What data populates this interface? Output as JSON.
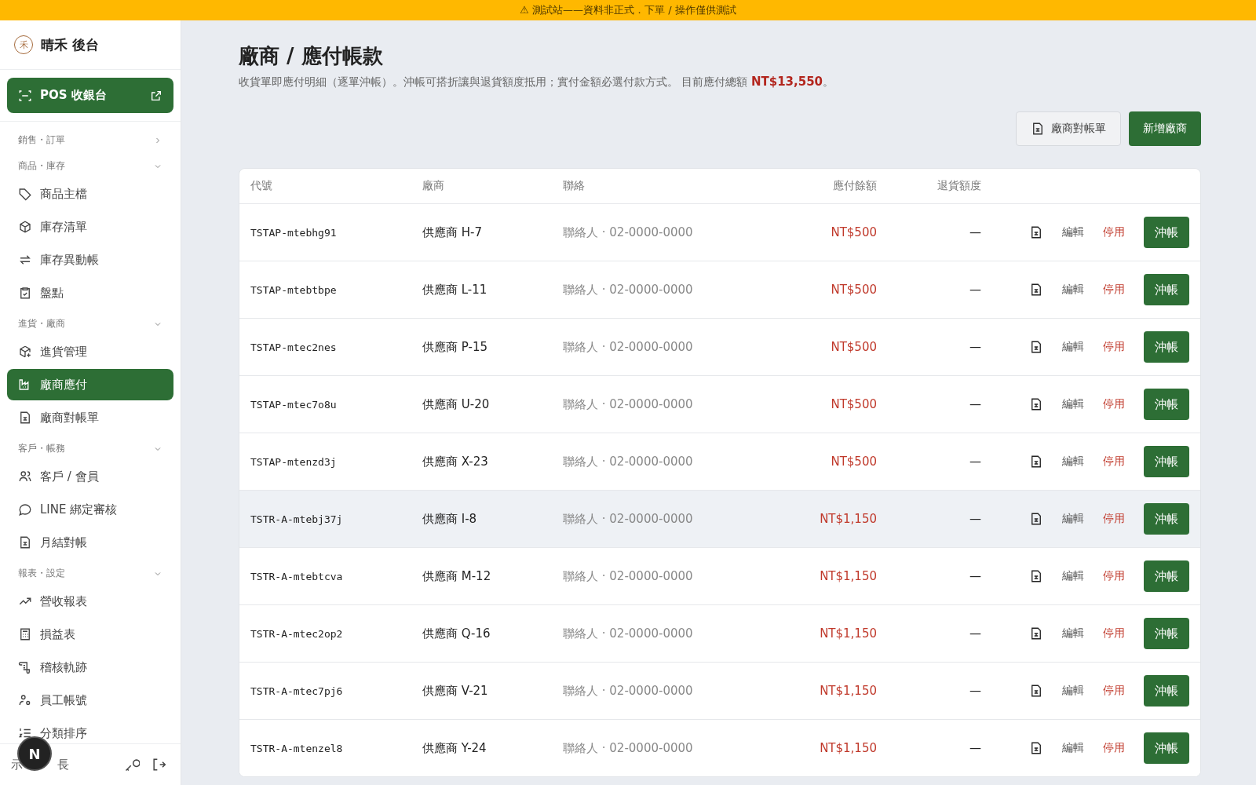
{
  "banner": {
    "icon": "⚠",
    "text": "測試站——資料非正式．下單 / 操作僅供測試"
  },
  "sidebar": {
    "brand": {
      "mark": "禾",
      "name": "晴禾 後台"
    },
    "pos_button": {
      "label": "POS 收銀台"
    },
    "groups": [
      {
        "label": "銷售・訂單",
        "expanded": false
      },
      {
        "label": "商品・庫存",
        "expanded": true,
        "items": [
          {
            "label": "商品主檔",
            "selected": false
          },
          {
            "label": "庫存清單",
            "selected": false
          },
          {
            "label": "庫存異動帳",
            "selected": false
          },
          {
            "label": "盤點",
            "selected": false
          }
        ]
      },
      {
        "label": "進貨・廠商",
        "expanded": true,
        "items": [
          {
            "label": "進貨管理",
            "selected": false
          },
          {
            "label": "廠商應付",
            "selected": true
          },
          {
            "label": "廠商對帳單",
            "selected": false
          }
        ]
      },
      {
        "label": "客戶・帳務",
        "expanded": true,
        "items": [
          {
            "label": "客戶 / 會員",
            "selected": false
          },
          {
            "label": "LINE 綁定審核",
            "selected": false
          },
          {
            "label": "月結對帳",
            "selected": false
          }
        ]
      },
      {
        "label": "報表・設定",
        "expanded": true,
        "items": [
          {
            "label": "營收報表",
            "selected": false
          },
          {
            "label": "損益表",
            "selected": false
          },
          {
            "label": "稽核軌跡",
            "selected": false
          },
          {
            "label": "員工帳號",
            "selected": false
          },
          {
            "label": "分類排序",
            "selected": false
          }
        ]
      }
    ],
    "user": {
      "name_parts": [
        "示",
        "長"
      ]
    },
    "dev_badge": "N"
  },
  "page": {
    "title": "廠商 / 應付帳款",
    "description": "收貨單即應付明細（逐單沖帳）。沖帳可搭折讓與退貨額度抵用；實付金額必選付款方式。 目前應付總額",
    "total": "NT$13,550",
    "description_end": "。",
    "actions": [
      {
        "label": "廠商對帳單",
        "kind": "secondary"
      },
      {
        "label": "新增廠商",
        "kind": "primary"
      }
    ]
  },
  "table": {
    "columns": [
      "代號",
      "廠商",
      "聯絡",
      "應付餘額",
      "退貨額度"
    ],
    "rows": [
      {
        "code": "TSTAP-mtebhg91",
        "vendor": "供應商 H-7",
        "contact": "聯絡人 · 02-0000-0000",
        "balance": "NT$500",
        "credit": "—",
        "hovered": false,
        "edit": "編輯",
        "disable": "停用",
        "settle": "沖帳"
      },
      {
        "code": "TSTAP-mtebtbpe",
        "vendor": "供應商 L-11",
        "contact": "聯絡人 · 02-0000-0000",
        "balance": "NT$500",
        "credit": "—",
        "hovered": false,
        "edit": "編輯",
        "disable": "停用",
        "settle": "沖帳"
      },
      {
        "code": "TSTAP-mtec2nes",
        "vendor": "供應商 P-15",
        "contact": "聯絡人 · 02-0000-0000",
        "balance": "NT$500",
        "credit": "—",
        "hovered": false,
        "edit": "編輯",
        "disable": "停用",
        "settle": "沖帳"
      },
      {
        "code": "TSTAP-mtec7o8u",
        "vendor": "供應商 U-20",
        "contact": "聯絡人 · 02-0000-0000",
        "balance": "NT$500",
        "credit": "—",
        "hovered": false,
        "edit": "編輯",
        "disable": "停用",
        "settle": "沖帳"
      },
      {
        "code": "TSTAP-mtenzd3j",
        "vendor": "供應商 X-23",
        "contact": "聯絡人 · 02-0000-0000",
        "balance": "NT$500",
        "credit": "—",
        "hovered": false,
        "edit": "編輯",
        "disable": "停用",
        "settle": "沖帳"
      },
      {
        "code": "TSTR-A-mtebj37j",
        "vendor": "供應商 I-8",
        "contact": "聯絡人 · 02-0000-0000",
        "balance": "NT$1,150",
        "credit": "—",
        "hovered": true,
        "edit": "編輯",
        "disable": "停用",
        "settle": "沖帳"
      },
      {
        "code": "TSTR-A-mtebtcva",
        "vendor": "供應商 M-12",
        "contact": "聯絡人 · 02-0000-0000",
        "balance": "NT$1,150",
        "credit": "—",
        "hovered": false,
        "edit": "編輯",
        "disable": "停用",
        "settle": "沖帳"
      },
      {
        "code": "TSTR-A-mtec2op2",
        "vendor": "供應商 Q-16",
        "contact": "聯絡人 · 02-0000-0000",
        "balance": "NT$1,150",
        "credit": "—",
        "hovered": false,
        "edit": "編輯",
        "disable": "停用",
        "settle": "沖帳"
      },
      {
        "code": "TSTR-A-mtec7pj6",
        "vendor": "供應商 V-21",
        "contact": "聯絡人 · 02-0000-0000",
        "balance": "NT$1,150",
        "credit": "—",
        "hovered": false,
        "edit": "編輯",
        "disable": "停用",
        "settle": "沖帳"
      },
      {
        "code": "TSTR-A-mtenzel8",
        "vendor": "供應商 Y-24",
        "contact": "聯絡人 · 02-0000-0000",
        "balance": "NT$1,150",
        "credit": "—",
        "hovered": false,
        "edit": "編輯",
        "disable": "停用",
        "settle": "沖帳"
      }
    ]
  }
}
